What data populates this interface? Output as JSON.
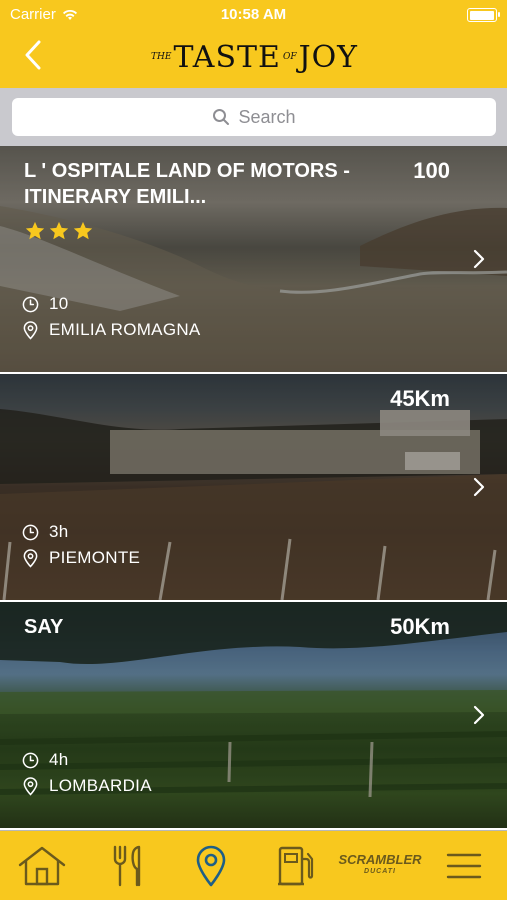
{
  "status_bar": {
    "carrier": "Carrier",
    "time": "10:58 AM"
  },
  "header": {
    "logo_small_left": "THE",
    "logo_word1": "TASTE",
    "logo_small_mid": "OF",
    "logo_word2": "JOY"
  },
  "search": {
    "placeholder": "Search"
  },
  "cards": [
    {
      "title": "L ' OSPITALE LAND OF MOTORS - ITINERARY EMILI...",
      "distance": "100",
      "rating": 3,
      "time": "10",
      "region": "EMILIA ROMAGNA"
    },
    {
      "title": "",
      "distance": "45Km",
      "time": "3h",
      "region": "PIEMONTE"
    },
    {
      "title": "SAY",
      "distance": "50Km",
      "time": "4h",
      "region": "LOMBARDIA"
    }
  ],
  "tabbar": {
    "items": [
      "home-icon",
      "fork-knife-icon",
      "map-pin-icon",
      "fuel-pump-icon",
      "scrambler-logo",
      "menu-icon"
    ],
    "scrambler_label": "SCRAMBLER",
    "scrambler_sub": "DUCATI"
  },
  "colors": {
    "accent": "#f8c81e",
    "search_bg": "#c9c9ce",
    "tab_icon": "#6b5a1c",
    "tab_active": "#1f5f86"
  }
}
